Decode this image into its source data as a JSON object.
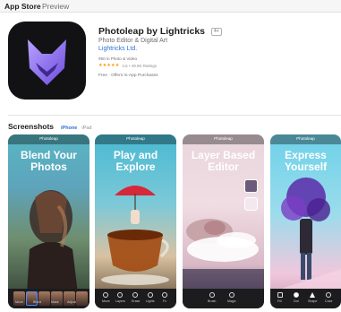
{
  "topbar": {
    "store": "App Store",
    "preview": "Preview"
  },
  "app": {
    "title": "Photoleap by Lightricks",
    "age_badge": "4+",
    "subtitle": "Photo Editor & Digital Art",
    "developer": "Lightricks Ltd.",
    "rank": "#50 in Photo & Video",
    "stars": "★★★★★",
    "rating": "4.6 • 49.9K Ratings",
    "price": "Free · Offers In-App Purchases"
  },
  "screenshots": {
    "title": "Screenshots",
    "tabs": [
      "iPhone",
      "iPad"
    ],
    "items": [
      {
        "app_name": "Photoleap",
        "headline_1": "Blend Your",
        "headline_2": "Photos"
      },
      {
        "app_name": "Photoleap",
        "headline_1": "Play and",
        "headline_2": "Explore"
      },
      {
        "app_name": "Photoleap",
        "headline_1": "Layer Based",
        "headline_2": "Editor"
      },
      {
        "app_name": "Photoleap",
        "headline_1": "Express",
        "headline_2": "Yourself"
      }
    ],
    "tools_1": [
      "Move",
      "Blend",
      "Mask",
      "Adjust"
    ],
    "tools_2": [
      "Move",
      "Layers",
      "Erase",
      "Lights",
      "Fx"
    ],
    "tools_3": [
      "Brush",
      "Magic"
    ],
    "tools_4": [
      "Fill",
      "Dot",
      "Shape",
      "Color"
    ]
  },
  "colors": {
    "accent": "#2f6fd6",
    "stars": "#ff9500"
  }
}
